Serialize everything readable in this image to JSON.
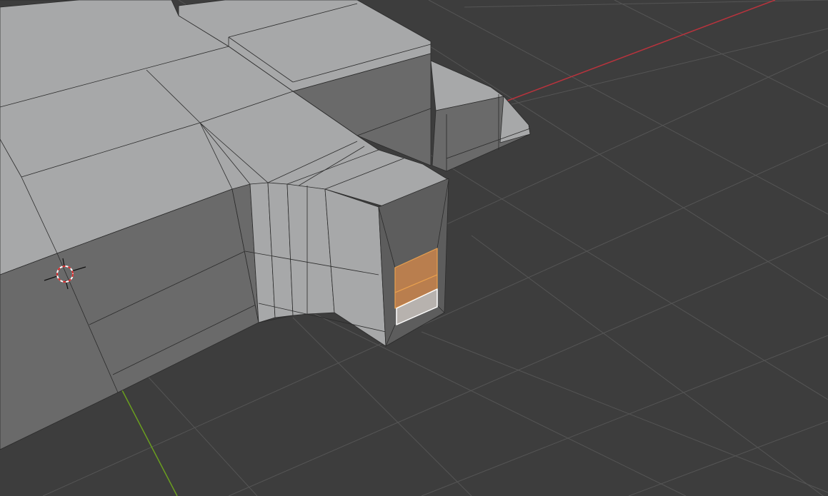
{
  "viewport": {
    "title": "",
    "background": "#3d3d3d",
    "grid_color": "#555555",
    "x_axis_color": "#b8333d",
    "y_axis_color": "#6a9e1f",
    "mesh": {
      "top_face_color": "#a7a8a9",
      "side_face_color": "#6a6a6a",
      "dark_side_color": "#5d5d5d",
      "edge_color": "#2b2b2b",
      "selected_face_color": "#d8894a",
      "selected_edge_color": "#e8a14f",
      "active_face_color": "#b7b2ae",
      "active_edge_color": "#ffffff"
    },
    "cursor": {
      "icon": "3d-cursor-icon",
      "ring_color_a": "#d92b2b",
      "ring_color_b": "#ffffff"
    }
  }
}
